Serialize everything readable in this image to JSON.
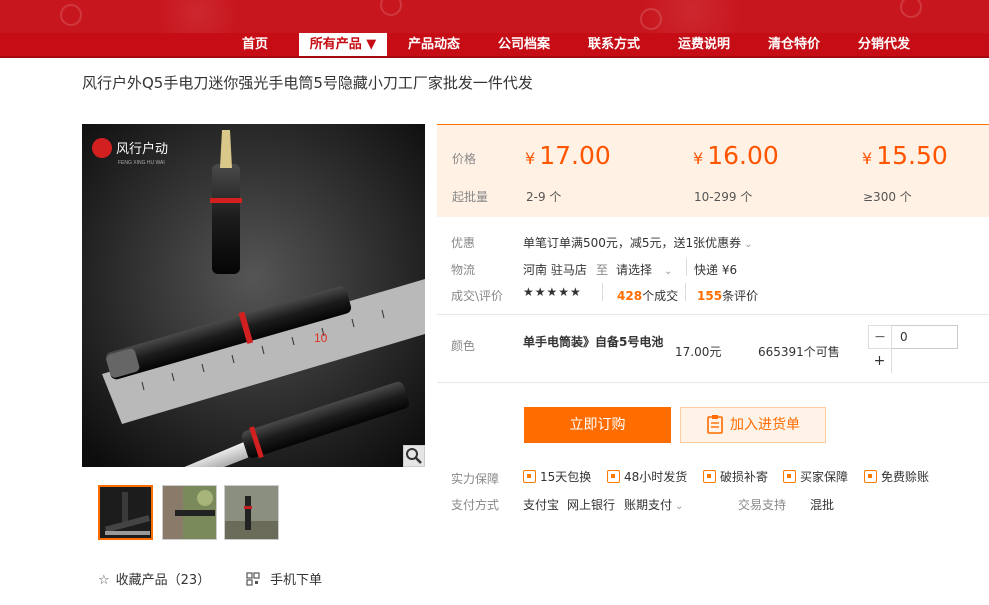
{
  "nav": {
    "items": [
      "首页",
      "所有产品 ▼",
      "产品动态",
      "公司档案",
      "联系方式",
      "运费说明",
      "清仓特价",
      "分销代发"
    ]
  },
  "product": {
    "title": "风行户外Q5手电刀迷你强光手电筒5号隐藏小刀工厂家批发一件代发",
    "image_logo": "风行户动",
    "image_logo_sub": "FENG XING HU WAI",
    "ruler_mark": "10"
  },
  "price": {
    "price_label": "价格",
    "moq_label": "起批量",
    "currency": "¥",
    "tiers": [
      {
        "price": "17.00",
        "qty": "2-9 个"
      },
      {
        "price": "16.00",
        "qty": "10-299 个"
      },
      {
        "price": "15.50",
        "qty": "≥300 个"
      }
    ]
  },
  "info": {
    "promo_label": "优惠",
    "promo_value": "单笔订单满500元，减5元，送1张优惠券",
    "logistics_label": "物流",
    "origin": "河南 驻马店",
    "to": "至",
    "dest": "请选择",
    "express": "快递 ¥6",
    "deals_label": "成交\\评价",
    "stars": "★★★★★",
    "deals_count": "428",
    "deals_suffix": "个成交",
    "reviews_count": "155",
    "reviews_suffix": "条评价"
  },
  "sku": {
    "color_label": "颜色",
    "name": "单手电筒装》自备5号电池",
    "price": "17.00元",
    "stock": "665391个可售",
    "qty": "0",
    "minus": "−",
    "plus": "+"
  },
  "actions": {
    "buy": "立即订购",
    "cart": "加入进货单"
  },
  "guarantee": {
    "label": "实力保障",
    "items": [
      "15天包换",
      "48小时发货",
      "破损补寄",
      "买家保障",
      "免费赊账"
    ]
  },
  "payment": {
    "label": "支付方式",
    "methods": [
      "支付宝",
      "网上银行",
      "账期支付"
    ],
    "trade_label": "交易支持",
    "trade_value": "混批"
  },
  "footer": {
    "favorite": "收藏产品（23）",
    "mobile": "手机下单"
  },
  "colors": {
    "brand_red": "#c60c14",
    "accent_orange": "#ff6c00",
    "price_orange": "#ff5500"
  }
}
